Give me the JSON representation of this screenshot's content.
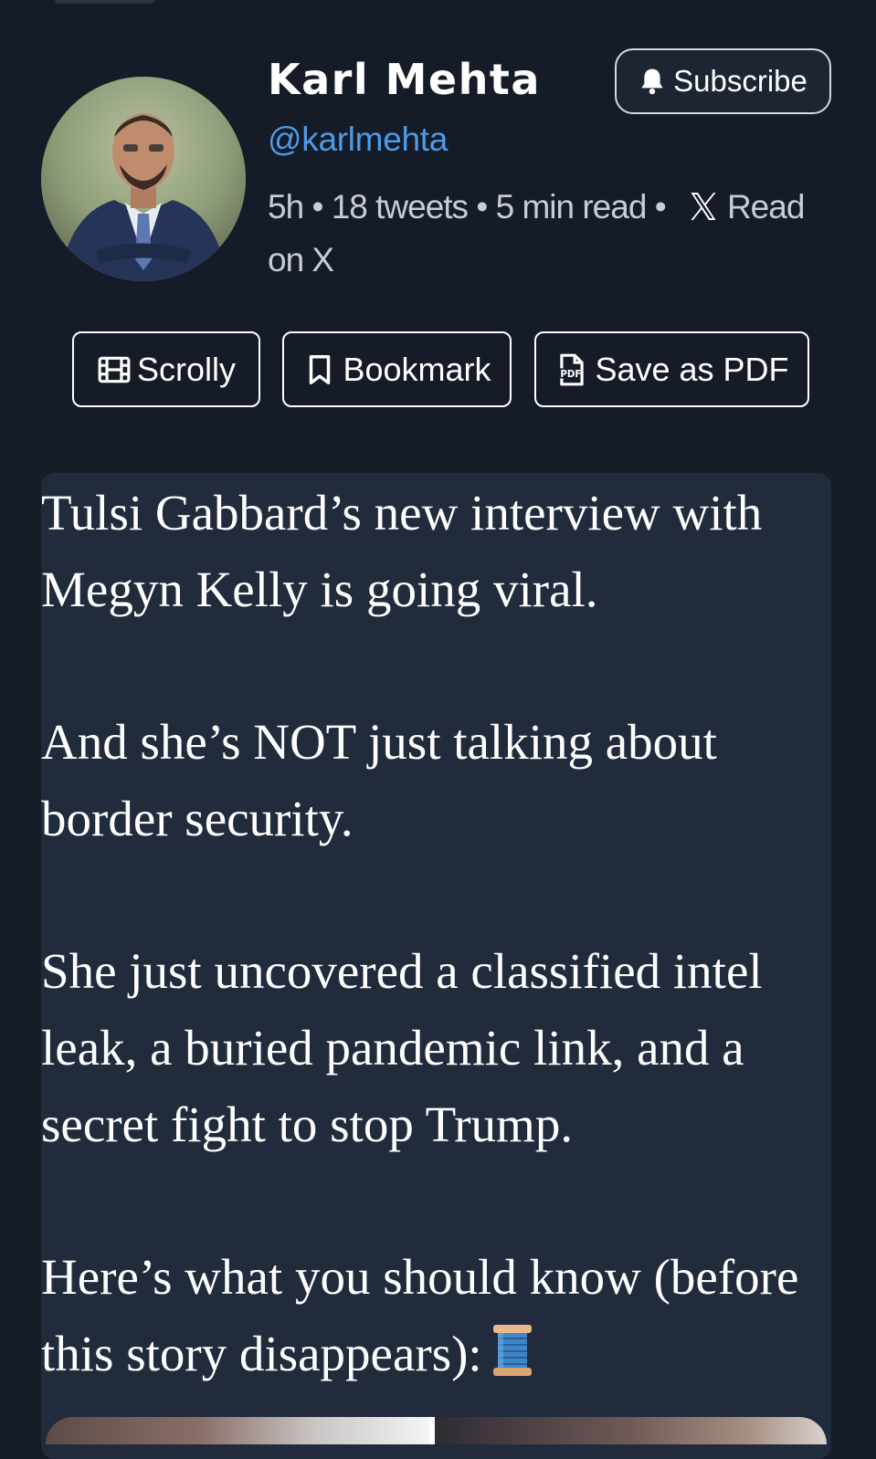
{
  "author": {
    "name": "Karl Mehta",
    "handle": "@karlmehta",
    "avatar_icon": "profile-photo"
  },
  "meta": {
    "age": "5h",
    "separator": "•",
    "tweet_count": "18 tweets",
    "read_time": "5 min read",
    "platform_icon": "x-logo-icon",
    "read_on": "Read on X"
  },
  "subscribe": {
    "label": "Subscribe",
    "icon": "bell-icon"
  },
  "actions": {
    "scrolly": {
      "label": "Scrolly",
      "icon": "film-icon"
    },
    "bookmark": {
      "label": "Bookmark",
      "icon": "bookmark-icon"
    },
    "pdf": {
      "label": "Save as PDF",
      "icon": "pdf-file-icon"
    }
  },
  "tweet": {
    "paragraphs": [
      "Tulsi Gabbard’s new interview with Megyn Kelly is going viral.",
      "And she’s NOT just talking about border security.",
      "She just uncovered a classified intel leak, a buried pandemic link, and a secret fight to stop Trump.",
      "Here’s what you should know (before this story disappears):"
    ],
    "thread_emoji": "spool-of-thread-icon"
  },
  "colors": {
    "background": "#151b27",
    "card": "#212b3c",
    "handle": "#4d9be6",
    "meta_text": "#c8ccd3"
  }
}
